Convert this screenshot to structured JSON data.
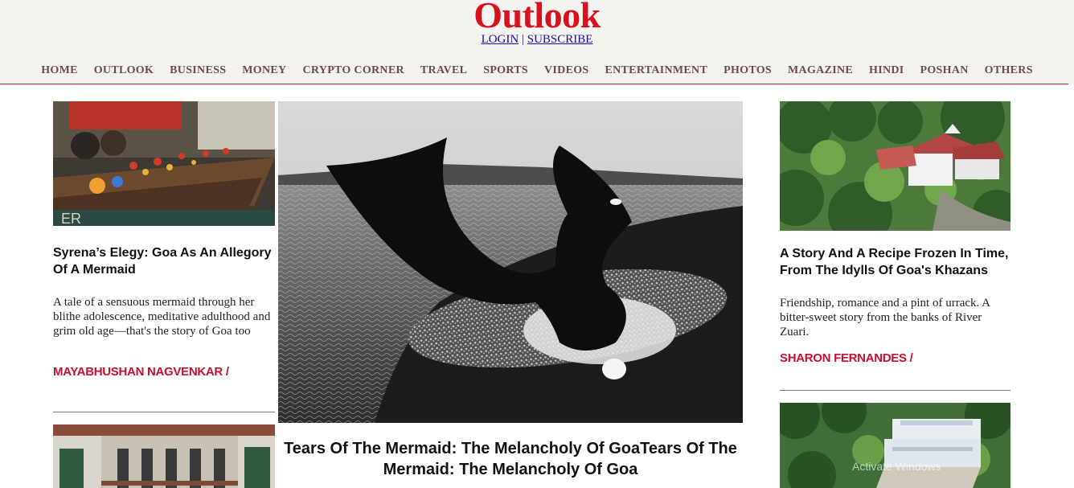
{
  "header": {
    "logo": "Outlook",
    "login_label": "LOGIN",
    "separator": "|",
    "subscribe_label": "SUBSCRIBE"
  },
  "nav": {
    "items": [
      "HOME",
      "OUTLOOK",
      "BUSINESS",
      "MONEY",
      "CRYPTO CORNER",
      "TRAVEL",
      "SPORTS",
      "VIDEOS",
      "ENTERTAINMENT",
      "PHOTOS",
      "MAGAZINE",
      "HINDI",
      "POSHAN",
      "OTHERS"
    ]
  },
  "left": {
    "title": "Syrena’s Elegy: Goa As An Allegory Of A Mermaid",
    "description": "A tale of a sensuous mermaid through her blithe adolescence, meditative adulthood and grim old age—that's the story of Goa too",
    "author": "MAYABHUSHAN NAGVENKAR /"
  },
  "center": {
    "title": "Tears Of The Mermaid: The Melancholy Of GoaTears Of The Mermaid: The Melancholy Of Goa"
  },
  "right": {
    "title": "A Story And A Recipe Frozen In Time, From The Idylls Of Goa's Khazans",
    "description": "Friendship, romance and a pint of urrack. A bitter-sweet story from the banks of River Zuari.",
    "author": "SHARON FERNANDES /"
  },
  "watermark": "Activate Windows",
  "colors": {
    "brand_red": "#d8111f",
    "author_red": "#c8102e",
    "nav_text": "#6b4b4b",
    "header_bg": "#f5f3f0"
  }
}
